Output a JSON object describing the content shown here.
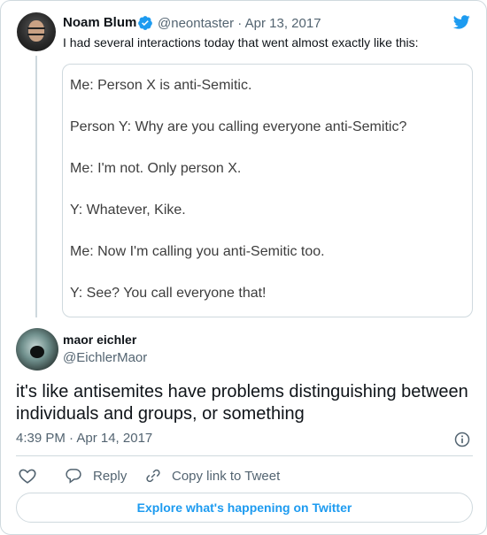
{
  "parent_tweet": {
    "author_name": "Noam Blum",
    "handle": "@neontaster",
    "separator": "·",
    "date": "Apr 13, 2017",
    "text": "I had several interactions today that went almost exactly like this:",
    "image_lines": [
      "Me: Person X is anti-Semitic.",
      "Person Y: Why are you calling everyone anti-Semitic?",
      "Me: I'm not. Only person X.",
      "Y: Whatever, Kike.",
      "Me: Now I'm calling you anti-Semitic too.",
      "Y: See? You call everyone that!"
    ]
  },
  "main_tweet": {
    "author_name": "maor eichler",
    "handle": "@EichlerMaor",
    "text": "it's like antisemites have problems distinguishing between individuals and groups, or something",
    "timestamp": "4:39 PM · Apr 14, 2017"
  },
  "actions": {
    "reply_label": "Reply",
    "copy_label": "Copy link to Tweet"
  },
  "explore_label": "Explore what's happening on Twitter",
  "colors": {
    "accent": "#1d9bf0",
    "muted": "#536471",
    "border": "#cfd9de"
  },
  "icons": {
    "verified": "verified-badge-icon",
    "logo": "twitter-bird-icon",
    "info": "info-icon",
    "like": "heart-icon",
    "reply": "reply-bubble-icon",
    "copy": "link-icon"
  }
}
